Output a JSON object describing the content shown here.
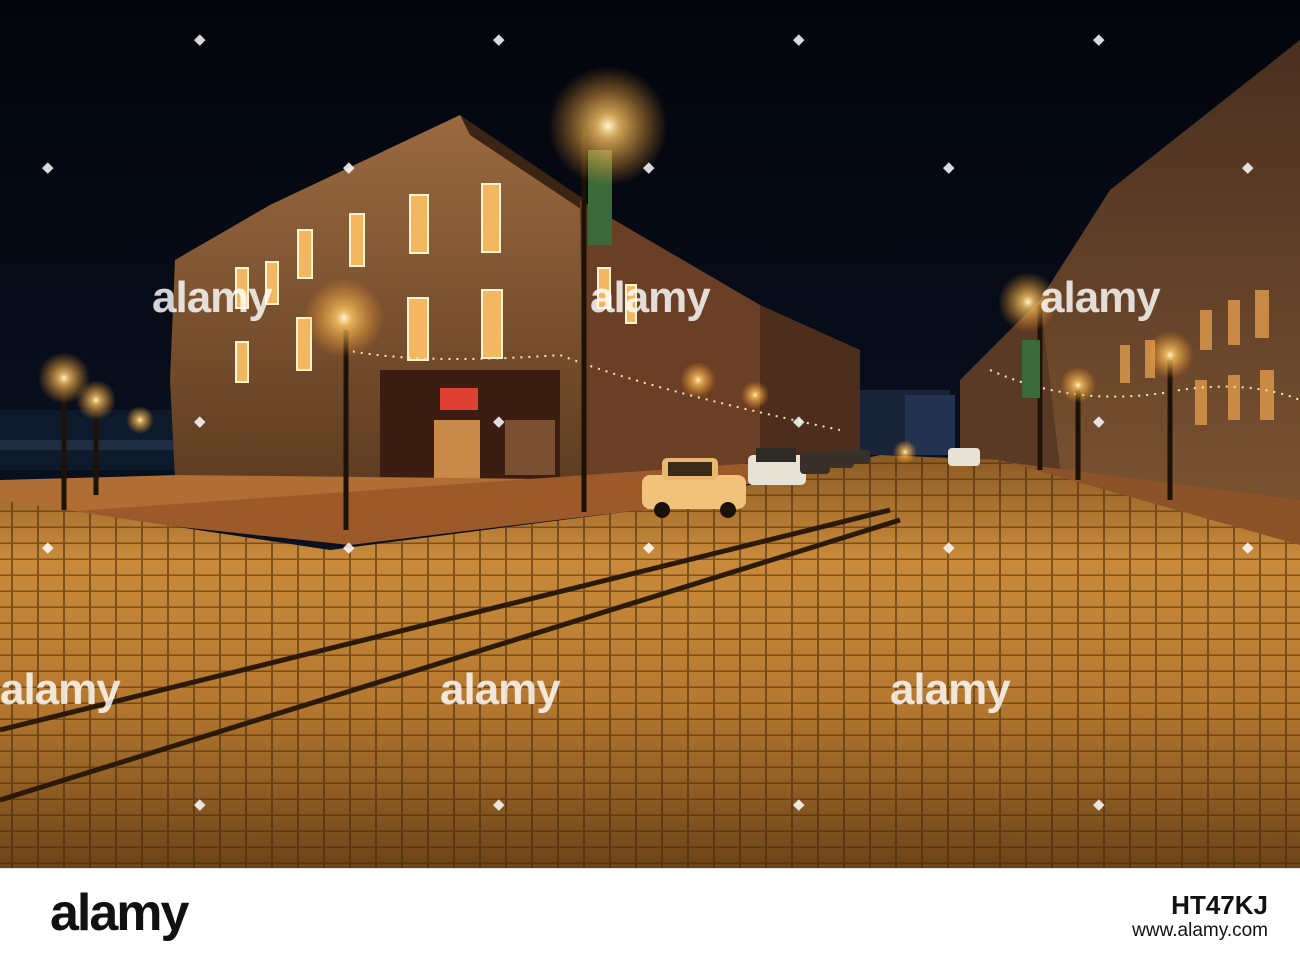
{
  "photo": {
    "description_icon": "night-cobblestone-street-photo",
    "watermark_text": "alamy",
    "colors": {
      "sky": "#05080f",
      "street_glow": "#d08a2a",
      "lamp": "#ffd27a",
      "brick": "#7a4a2c"
    }
  },
  "footer": {
    "brand": "alamy",
    "image_id": "HT47KJ",
    "site": "www.alamy.com"
  }
}
